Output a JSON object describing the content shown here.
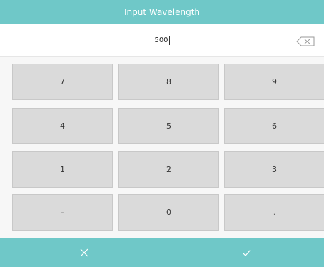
{
  "dialog": {
    "title": "Input Wavelength"
  },
  "input": {
    "value": "500",
    "backspace_icon": "backspace-icon"
  },
  "keypad": {
    "keys": [
      "7",
      "8",
      "9",
      "4",
      "5",
      "6",
      "1",
      "2",
      "3",
      "-",
      "0",
      "."
    ]
  },
  "actions": {
    "cancel_icon": "close-icon",
    "confirm_icon": "checkmark-icon"
  },
  "colors": {
    "accent": "#6fc8c8",
    "key_bg": "#dadada",
    "key_border": "#c8c8c8",
    "text": "#333333"
  }
}
